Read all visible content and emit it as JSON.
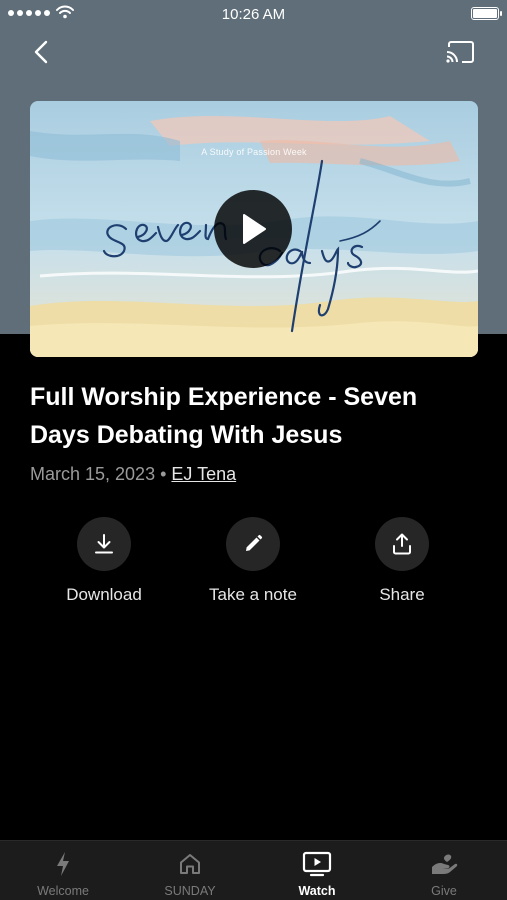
{
  "status_bar": {
    "time": "10:26 AM"
  },
  "video": {
    "subtitle": "A Study of Passion Week",
    "script_text": "seven days"
  },
  "sermon": {
    "title": "Full Worship Experience - Seven Days Debating With Jesus",
    "date": "March 15, 2023",
    "separator": "•",
    "author": "EJ Tena"
  },
  "actions": [
    {
      "label": "Download",
      "icon": "download-icon"
    },
    {
      "label": "Take a note",
      "icon": "pencil-icon"
    },
    {
      "label": "Share",
      "icon": "share-icon"
    }
  ],
  "tabs": [
    {
      "label": "Welcome",
      "icon": "lightning-icon",
      "active": false
    },
    {
      "label": "SUNDAY",
      "icon": "home-icon",
      "active": false
    },
    {
      "label": "Watch",
      "icon": "tv-play-icon",
      "active": true
    },
    {
      "label": "Give",
      "icon": "giving-hand-icon",
      "active": false
    }
  ],
  "colors": {
    "header_band": "#5f6e78",
    "background": "#000000",
    "tabbar": "#1c1c1c",
    "action_circle": "#262626"
  }
}
